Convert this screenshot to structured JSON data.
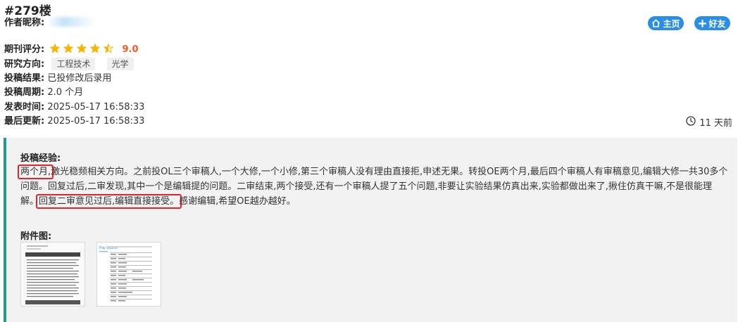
{
  "post": {
    "floor": "#279楼",
    "author_label": "作者昵称:",
    "rating_label": "期刊评分:",
    "rating_stars": 4.5,
    "rating_score": "9.0",
    "direction_label": "研究方向:",
    "directions": [
      "工程技术",
      "光学"
    ],
    "result_label": "投稿结果:",
    "result_value": "已投修改后录用",
    "cycle_label": "投稿周期:",
    "cycle_value": "2.0 个月",
    "published_label": "发表时间:",
    "published_value": "2025-05-17 16:58:33",
    "updated_label": "最后更新:",
    "updated_value": "2025-05-17 16:58:33",
    "time_ago": "11 天前"
  },
  "buttons": {
    "home": "主页",
    "friend": "好友"
  },
  "experience": {
    "title": "投稿经验:",
    "hl1": "两个月,",
    "part1": "激光稳频相关方向。之前投OL三个审稿人,一个大修,一个小修,第三个审稿人没有理由直接拒,申述无果。转投OE两个月,最后四个审稿人有审稿意见,编辑大修一共30多个问题。回复过后,二审发现,其中一个是编辑提的问题。二审结束,两个接受,还有一个审稿人提了五个问题,非要让实验结果仿真出来,实验都做出来了,揪住仿真干嘛,不是很能理解。",
    "hl2": "回复二审意见过后,编辑直接接受。",
    "part2": "感谢编辑,希望OE越办越好。"
  },
  "attachments": {
    "title": "附件图:",
    "thumb2_heading": "Pay Source"
  },
  "colors": {
    "accent": "#2a8de6",
    "star": "#f7b500",
    "score": "#f05a28",
    "panel_border": "#1e9c8c",
    "highlight": "#e3252b"
  }
}
